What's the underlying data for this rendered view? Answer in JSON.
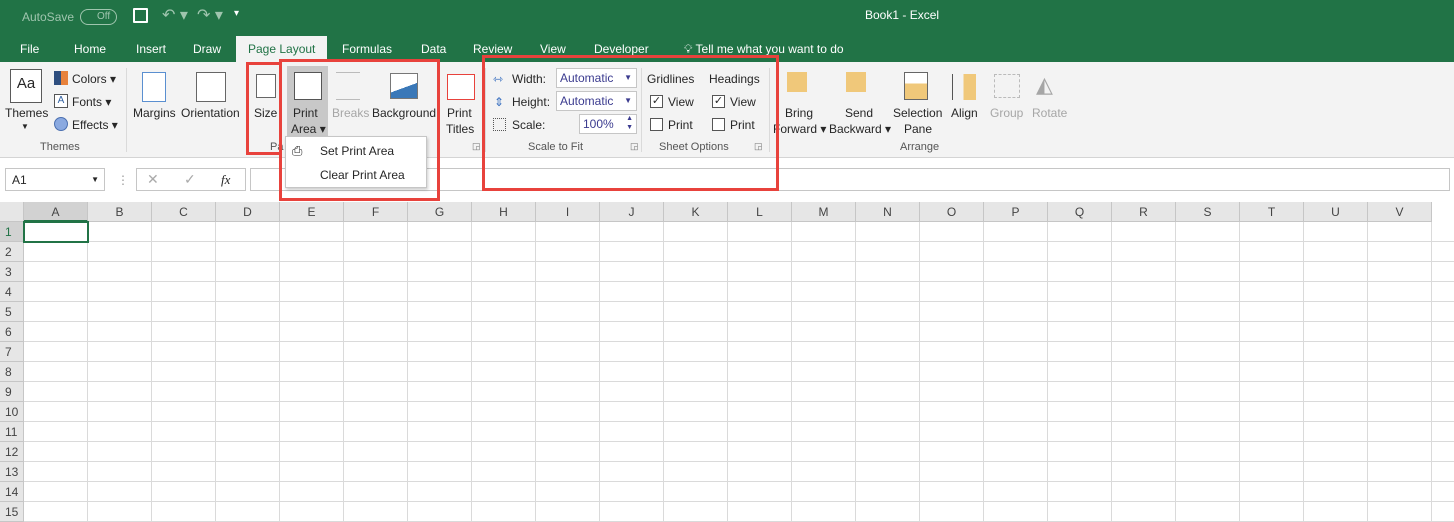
{
  "titlebar": {
    "autosave": "AutoSave",
    "toggle": "Off",
    "title": "Book1  -  Excel"
  },
  "tabs": [
    {
      "label": "File"
    },
    {
      "label": "Home"
    },
    {
      "label": "Insert"
    },
    {
      "label": "Draw"
    },
    {
      "label": "Page Layout",
      "active": true
    },
    {
      "label": "Formulas"
    },
    {
      "label": "Data"
    },
    {
      "label": "Review"
    },
    {
      "label": "View"
    },
    {
      "label": "Developer"
    }
  ],
  "tell_me": "Tell me what you want to do",
  "ribbon": {
    "themes": {
      "themes": "Themes",
      "colors": "Colors",
      "fonts": "Fonts",
      "effects": "Effects",
      "group": "Themes"
    },
    "page_setup": {
      "margins": "Margins",
      "orientation": "Orientation",
      "size": "Size",
      "print": "Print",
      "area": "Area",
      "breaks": "Breaks",
      "background": "Background",
      "print2": "Print",
      "titles": "Titles",
      "group": "Pa"
    },
    "scale": {
      "width_label": "Width:",
      "width_value": "Automatic",
      "height_label": "Height:",
      "height_value": "Automatic",
      "scale_label": "Scale:",
      "scale_value": "100%",
      "group": "Scale to Fit"
    },
    "sheet": {
      "gridlines": "Gridlines",
      "headings": "Headings",
      "view": "View",
      "print": "Print",
      "gridlines_view": true,
      "gridlines_print": false,
      "headings_view": true,
      "headings_print": false,
      "group": "Sheet Options"
    },
    "arrange": {
      "bring": "Bring",
      "forward": "Forward",
      "send": "Send",
      "backward": "Backward",
      "selection": "Selection",
      "pane": "Pane",
      "align": "Align",
      "group_btn": "Group",
      "rotate": "Rotate",
      "group": "Arrange"
    }
  },
  "menu": {
    "items": [
      "Set Print Area",
      "Clear Print Area"
    ]
  },
  "formula_bar": {
    "name_box": "A1",
    "fx": "fx",
    "value": ""
  },
  "columns": [
    "A",
    "B",
    "C",
    "D",
    "E",
    "F",
    "G",
    "H",
    "I",
    "J",
    "K",
    "L",
    "M",
    "N",
    "O",
    "P",
    "Q",
    "R",
    "S",
    "T",
    "U",
    "V"
  ],
  "rows": [
    "1",
    "2",
    "3",
    "4",
    "5",
    "6",
    "7",
    "8",
    "9",
    "10",
    "11",
    "12",
    "13",
    "14",
    "15"
  ],
  "colors": {
    "accent": "#217346",
    "highlight": "#e8423c"
  }
}
